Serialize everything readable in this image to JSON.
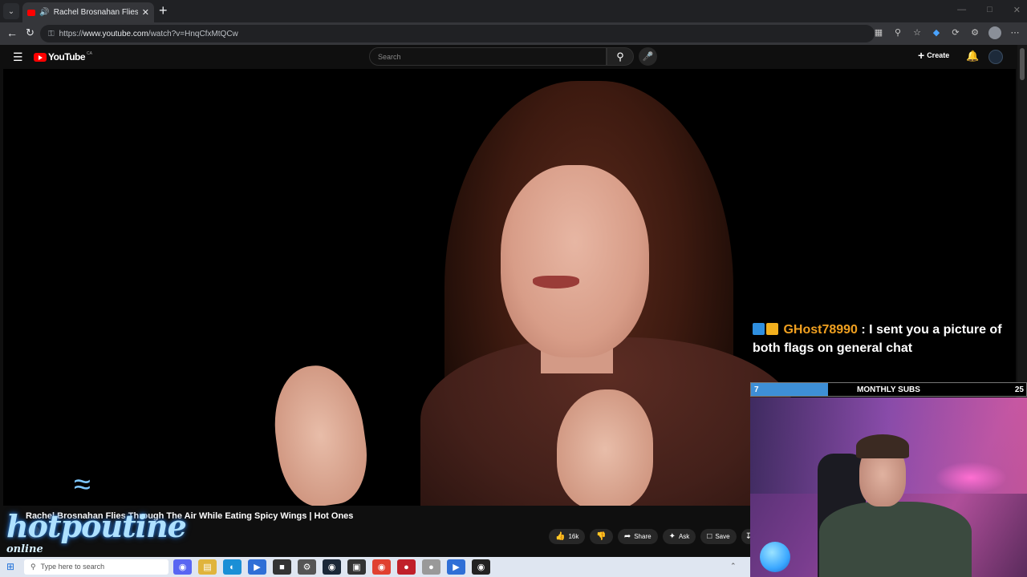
{
  "browser": {
    "tab_title": "Rachel Brosnahan Flies Throu",
    "url_prefix": "https://",
    "url_host": "www.youtube.com",
    "url_path": "/watch?v=HnqCfxMtQCw"
  },
  "youtube": {
    "logo_text": "YouTube",
    "region": "CA",
    "search_placeholder": "Search",
    "create_label": "Create"
  },
  "video": {
    "title": "Rachel Brosnahan Flies Through The Air While Eating Spicy Wings | Hot Ones",
    "likes": "16k",
    "share_label": "Share",
    "ask_label": "Ask",
    "save_label": "Save"
  },
  "overlay": {
    "watermark_brand": "hotpoutine",
    "watermark_tag": "online",
    "chat_user": "GHost78990",
    "chat_sep": " : ",
    "chat_message": "I sent you a picture of both flags on general chat",
    "subs_current": "7",
    "subs_label": "MONTHLY SUBS",
    "subs_goal": "25",
    "subs_fraction": 0.28,
    "colors": {
      "user": "#f0a020",
      "bar_fill": "#3e8fd6",
      "accent_red": "#ff0000"
    }
  },
  "taskbar": {
    "search_placeholder": "Type here to search"
  },
  "icons": [
    "tab-list-icon",
    "speaker-icon",
    "close-icon",
    "new-tab-icon",
    "back-icon",
    "reload-icon",
    "lock-icon",
    "menu-icon",
    "search-icon",
    "mic-icon",
    "bell-icon",
    "like-icon",
    "dislike-icon",
    "share-icon",
    "ask-icon",
    "save-icon",
    "download-icon",
    "windows-start-icon"
  ]
}
